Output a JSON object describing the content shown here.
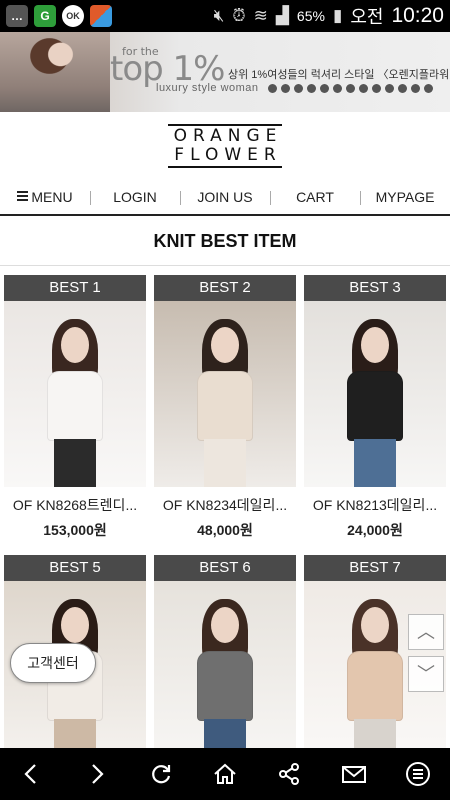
{
  "status_bar": {
    "battery": "65%",
    "carrier": "오전",
    "time": "10:20",
    "apps": [
      {
        "icon": "message-icon",
        "label": "",
        "color": "#555555"
      },
      {
        "icon": "green-g-icon",
        "label": "G",
        "color": "#2e9e3a"
      },
      {
        "icon": "ok-cashbag-icon",
        "label": "OK",
        "color": "#444444"
      },
      {
        "icon": "home-app-icon",
        "label": "",
        "color": "#e05a2a"
      }
    ]
  },
  "banner": {
    "forthe": "for the",
    "big": "top 1%",
    "korean": "상위 1%여성들의 럭셔리 스타일 〈오렌지플라워〉",
    "sub": "luxury style woman"
  },
  "logo": {
    "line1": "ORANGE",
    "line2": "FLOWER"
  },
  "nav": {
    "menu": "MENU",
    "login": "LOGIN",
    "join": "JOIN US",
    "cart": "CART",
    "mypage": "MYPAGE"
  },
  "section": {
    "title": "KNIT BEST ITEM"
  },
  "products": [
    {
      "badge": "BEST 1",
      "name": "OF KN8268트렌디...",
      "price": "153,000원",
      "bg": "#eae6e3",
      "hair": "#3a2720",
      "top": "#f7f5f3",
      "bottom": "#2b2b2b"
    },
    {
      "badge": "BEST 2",
      "name": "OF KN8234데일리...",
      "price": "48,000원",
      "bg": "#c7bcb0",
      "hair": "#2e221c",
      "top": "#e9ddd0",
      "bottom": "#ede6de"
    },
    {
      "badge": "BEST 3",
      "name": "OF KN8213데일리...",
      "price": "24,000원",
      "bg": "#e3e0dc",
      "hair": "#2a1d18",
      "top": "#1f1f1f",
      "bottom": "#4e6f95"
    },
    {
      "badge": "BEST 5",
      "name": "",
      "price": "",
      "bg": "#ded6cc",
      "hair": "#2a1c16",
      "top": "#f1ece6",
      "bottom": "#cdb9a5"
    },
    {
      "badge": "BEST 6",
      "name": "",
      "price": "",
      "bg": "#e6e2dc",
      "hair": "#3b281f",
      "top": "#6f6f6f",
      "bottom": "#3f5b7e"
    },
    {
      "badge": "BEST 7",
      "name": "",
      "price": "",
      "bg": "#efeae5",
      "hair": "#4a3228",
      "top": "#e3c6ae",
      "bottom": "#d8d3cd"
    }
  ],
  "floating": {
    "customer_center": "고객센터",
    "scroll_up": "︿",
    "scroll_down": "﹀"
  },
  "bottom_bar": [
    "back-icon",
    "forward-icon",
    "refresh-icon",
    "home-icon",
    "share-icon",
    "mail-icon",
    "menu-icon"
  ]
}
